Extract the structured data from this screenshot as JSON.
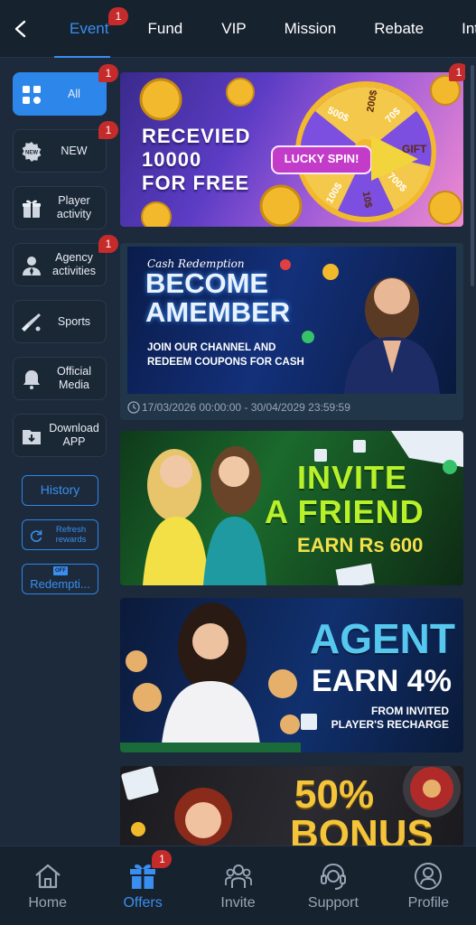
{
  "top_nav": {
    "tabs": [
      {
        "label": "Event",
        "badge": "1"
      },
      {
        "label": "Fund"
      },
      {
        "label": "VIP"
      },
      {
        "label": "Mission"
      },
      {
        "label": "Rebate"
      },
      {
        "label": "Inte"
      }
    ]
  },
  "sidebar": {
    "items": [
      {
        "label": "All",
        "badge": "1"
      },
      {
        "label": "NEW",
        "badge": "1",
        "icon_text": "NEW"
      },
      {
        "label": "Player activity"
      },
      {
        "label": "Agency activities",
        "badge": "1"
      },
      {
        "label": "Sports"
      },
      {
        "label": "Official Media"
      },
      {
        "label": "Download APP"
      }
    ],
    "history": "History",
    "refresh": "Refresh rewards",
    "redemption": "Redempti...",
    "redemption_icon": "OFF"
  },
  "promotions": [
    {
      "line1": "RECEVIED",
      "line2": "10000",
      "line3": "FOR FREE",
      "wheel_label": "LUCKY SPIN!",
      "badge": "1",
      "wheel_slices": [
        "200$",
        "70$",
        "GIFT",
        "700$",
        "10$",
        "100$",
        "500$"
      ]
    },
    {
      "script": "Cash Redemption",
      "line1": "BECOME",
      "line2": "AMEMBER",
      "sub1": "JOIN OUR CHANNEL AND",
      "sub2": "REDEEM COUPONS FOR CASH",
      "dates": "17/03/2026 00:00:00 - 30/04/2029 23:59:59"
    },
    {
      "line1": "INVITE",
      "line2": "A FRIEND",
      "line3": "EARN Rs 600"
    },
    {
      "line1": "AGENT",
      "line2": "EARN 4%",
      "sub1": "FROM INVITED",
      "sub2": "PLAYER'S RECHARGE"
    },
    {
      "line1": "50%",
      "line2": "BONUS"
    }
  ],
  "bottom_nav": {
    "items": [
      {
        "label": "Home"
      },
      {
        "label": "Offers",
        "badge": "1"
      },
      {
        "label": "Invite"
      },
      {
        "label": "Support"
      },
      {
        "label": "Profile"
      }
    ]
  },
  "colors": {
    "accent": "#2d86ea",
    "badge": "#c62b2b",
    "bg": "#1c2a3b"
  }
}
